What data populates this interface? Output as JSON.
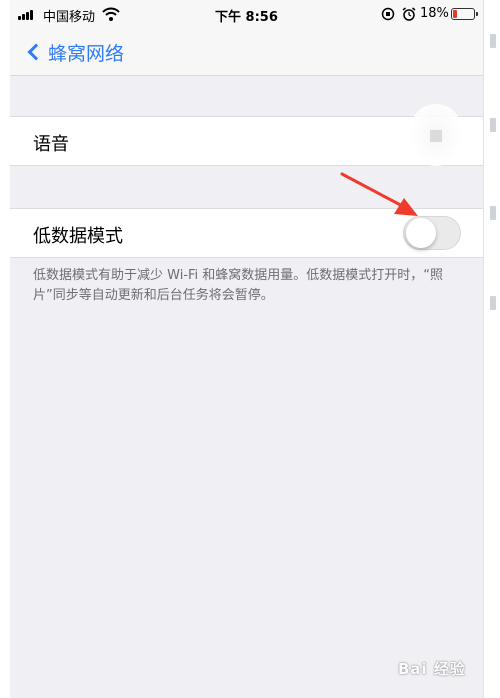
{
  "status_bar": {
    "carrier": "中国移动",
    "time": "下午 8:56",
    "battery_percent": "18%",
    "battery_level": 0.18,
    "battery_color": "#e23b2f",
    "icons": [
      "signal-icon",
      "wifi-icon",
      "rotation-lock-icon",
      "alarm-icon",
      "battery-icon"
    ]
  },
  "nav": {
    "back_label": "蜂窝网络",
    "accent_color": "#2f7cf6"
  },
  "cells": {
    "voice_label": "语音",
    "low_data_label": "低数据模式",
    "low_data_enabled": false
  },
  "footer_note": "低数据模式有助于减少 Wi-Fi 和蜂窝数据用量。低数据模式打开时，“照片”同步等自动更新和后台任务将会暂停。",
  "annotation": {
    "arrow_color": "#f03a2b"
  },
  "watermark": {
    "text": "Bai 经验"
  }
}
